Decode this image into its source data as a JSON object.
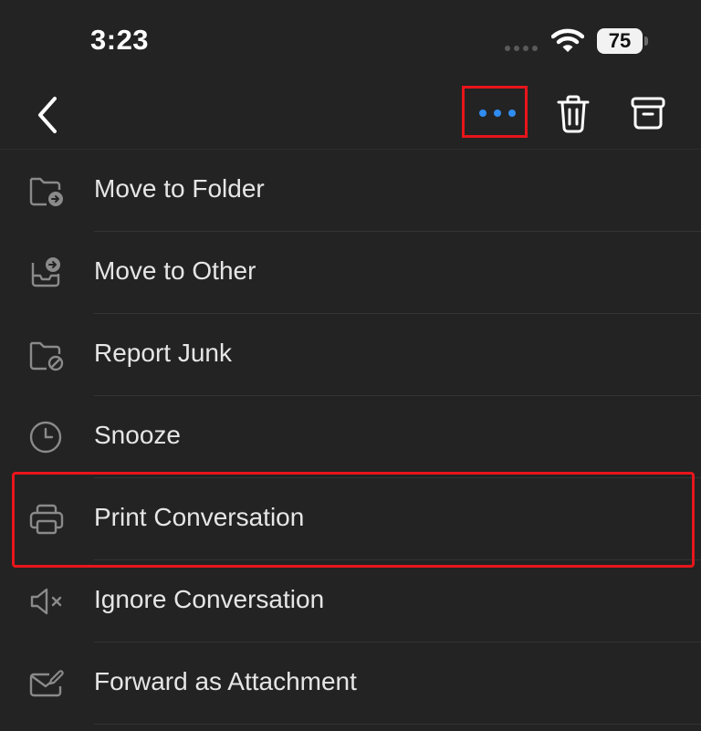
{
  "status_bar": {
    "time": "3:23",
    "battery_level": "75",
    "icons": [
      "cellular-signal-icon",
      "wifi-icon",
      "battery-icon"
    ]
  },
  "toolbar": {
    "buttons": [
      {
        "name": "back",
        "icon": "chevron-left-icon"
      },
      {
        "name": "more",
        "icon": "ellipsis-icon",
        "accent": "#2f8cf0"
      },
      {
        "name": "delete",
        "icon": "trash-icon"
      },
      {
        "name": "archive",
        "icon": "archive-box-icon"
      }
    ]
  },
  "menu": {
    "items": [
      {
        "label": "Move to Folder",
        "icon": "folder-move-icon"
      },
      {
        "label": "Move to Other",
        "icon": "tray-move-icon"
      },
      {
        "label": "Report Junk",
        "icon": "folder-block-icon"
      },
      {
        "label": "Snooze",
        "icon": "clock-icon"
      },
      {
        "label": "Print Conversation",
        "icon": "printer-icon"
      },
      {
        "label": "Ignore Conversation",
        "icon": "speaker-mute-icon"
      },
      {
        "label": "Forward as Attachment",
        "icon": "envelope-edit-icon"
      }
    ]
  },
  "colors": {
    "background": "#232323",
    "text": "#e6e6e6",
    "icon": "#8a8a8a",
    "accent": "#2f8cf0",
    "annotation": "#e8151b"
  }
}
